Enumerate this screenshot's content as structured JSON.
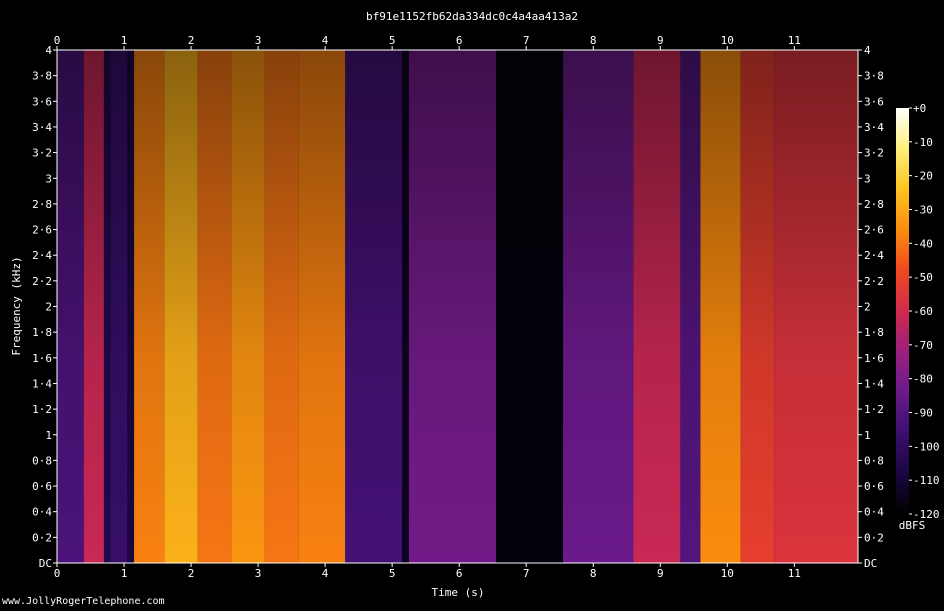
{
  "chart_data": {
    "type": "heatmap",
    "title": "bf91e1152fb62da334dc0c4a4aa413a2",
    "xlabel": "Time (s)",
    "ylabel": "Frequency (kHz)",
    "xlim": [
      0,
      11.95
    ],
    "ylim": [
      0,
      4
    ],
    "x_ticks": [
      0,
      1,
      2,
      3,
      4,
      5,
      6,
      7,
      8,
      9,
      10,
      11
    ],
    "x_tick_labels": [
      "0",
      "1",
      "2",
      "3",
      "4",
      "5",
      "6",
      "7",
      "8",
      "9",
      "10",
      "11"
    ],
    "y_ticks": [
      0,
      0.2,
      0.4,
      0.6,
      0.8,
      1,
      1.2,
      1.4,
      1.6,
      1.8,
      2,
      2.2,
      2.4,
      2.6,
      2.8,
      3,
      3.2,
      3.4,
      3.6,
      3.8,
      4
    ],
    "y_tick_labels": [
      "DC",
      "0·2",
      "0·4",
      "0·6",
      "0·8",
      "1",
      "1·2",
      "1·4",
      "1·6",
      "1·8",
      "2",
      "2·2",
      "2·4",
      "2·6",
      "2·8",
      "3",
      "3·2",
      "3·4",
      "3·6",
      "3·8",
      "4"
    ],
    "colorbar": {
      "label": "dBFS",
      "range": [
        -120,
        0
      ],
      "ticks": [
        0,
        -10,
        -20,
        -30,
        -40,
        -50,
        -60,
        -70,
        -80,
        -90,
        -100,
        -110,
        -120
      ],
      "tick_labels": [
        "+0",
        "-10",
        "-20",
        "-30",
        "-40",
        "-50",
        "-60",
        "-70",
        "-80",
        "-90",
        "-100",
        "-110",
        "-120"
      ],
      "colormap": [
        "#000000",
        "#1a0640",
        "#3b0f70",
        "#6a1a8a",
        "#9c1f7e",
        "#d12a4c",
        "#f0481f",
        "#fb8c0e",
        "#fcc420",
        "#fdf07a",
        "#ffffff"
      ]
    },
    "segments": [
      {
        "t0": 0.0,
        "t1": 0.4,
        "db": -92
      },
      {
        "t0": 0.4,
        "t1": 0.7,
        "db": -62
      },
      {
        "t0": 0.7,
        "t1": 0.8,
        "db": -105
      },
      {
        "t0": 0.8,
        "t1": 1.05,
        "db": -98
      },
      {
        "t0": 1.05,
        "t1": 1.15,
        "db": -108
      },
      {
        "t0": 1.15,
        "t1": 1.6,
        "db": -38
      },
      {
        "t0": 1.6,
        "t1": 2.1,
        "db": -28
      },
      {
        "t0": 2.1,
        "t1": 2.6,
        "db": -40
      },
      {
        "t0": 2.6,
        "t1": 3.1,
        "db": -34
      },
      {
        "t0": 3.1,
        "t1": 3.6,
        "db": -40
      },
      {
        "t0": 3.6,
        "t1": 4.3,
        "db": -38
      },
      {
        "t0": 4.3,
        "t1": 5.15,
        "db": -94
      },
      {
        "t0": 5.15,
        "t1": 5.25,
        "db": -114
      },
      {
        "t0": 5.25,
        "t1": 6.55,
        "db": -82
      },
      {
        "t0": 6.55,
        "t1": 7.55,
        "db": -118
      },
      {
        "t0": 7.55,
        "t1": 8.6,
        "db": -84
      },
      {
        "t0": 8.6,
        "t1": 9.3,
        "db": -62
      },
      {
        "t0": 9.3,
        "t1": 9.6,
        "db": -90
      },
      {
        "t0": 9.6,
        "t1": 10.2,
        "db": -36
      },
      {
        "t0": 10.2,
        "t1": 10.7,
        "db": -52
      },
      {
        "t0": 10.7,
        "t1": 11.95,
        "db": -56
      }
    ]
  },
  "watermark": "www.JollyRogerTelephone.com"
}
